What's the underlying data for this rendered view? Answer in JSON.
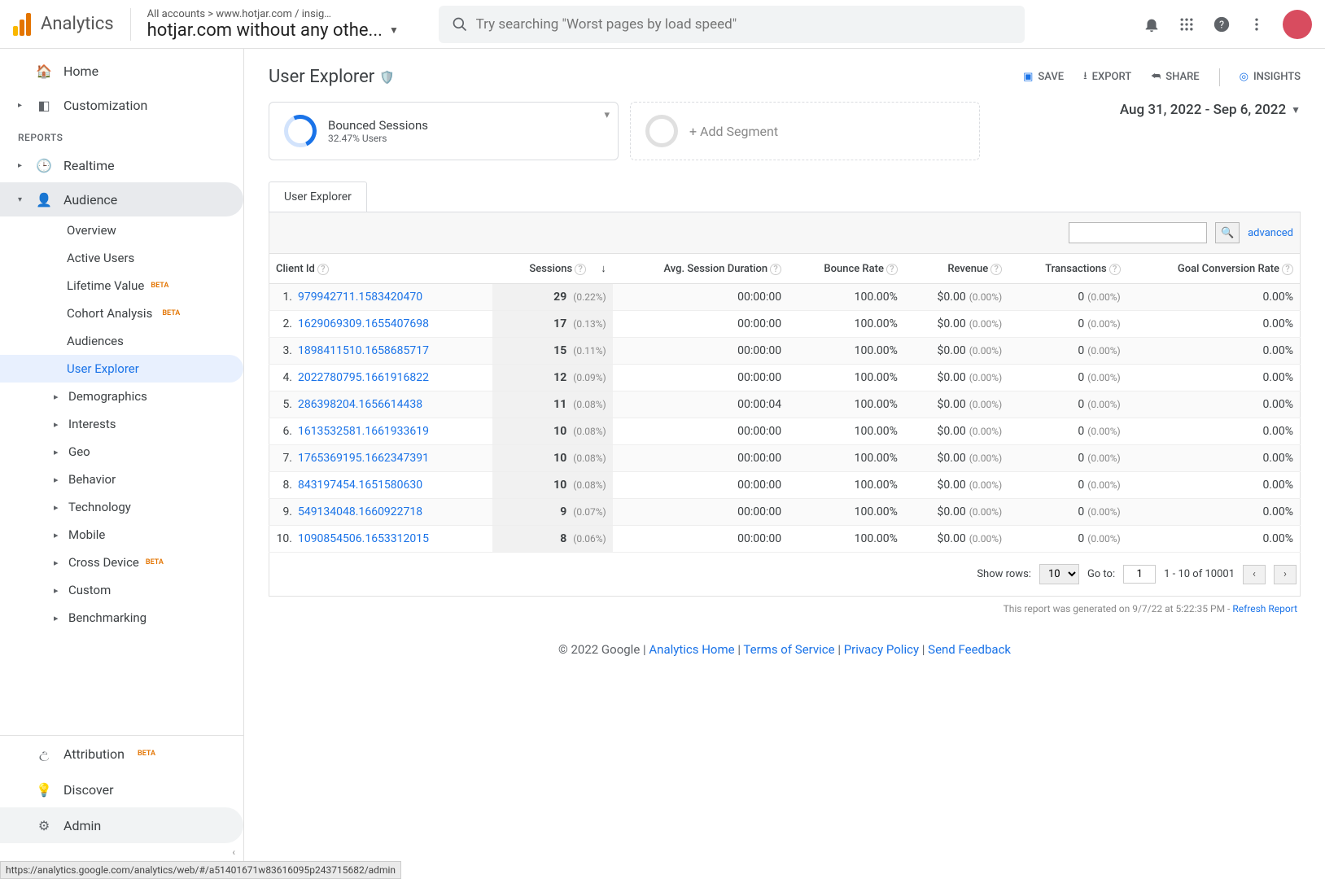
{
  "brand": "Analytics",
  "breadcrumb": "All accounts > www.hotjar.com / insig…",
  "property": "hotjar.com without any othe...",
  "search_placeholder": "Try searching \"Worst pages by load speed\"",
  "sidebar": {
    "home": "Home",
    "customization": "Customization",
    "reports_label": "REPORTS",
    "realtime": "Realtime",
    "audience": "Audience",
    "sub": {
      "overview": "Overview",
      "active_users": "Active Users",
      "lifetime_value": "Lifetime Value",
      "cohort": "Cohort Analysis",
      "audiences": "Audiences",
      "user_explorer": "User Explorer",
      "demographics": "Demographics",
      "interests": "Interests",
      "geo": "Geo",
      "behavior": "Behavior",
      "technology": "Technology",
      "mobile": "Mobile",
      "cross_device": "Cross Device",
      "custom": "Custom",
      "benchmarking": "Benchmarking"
    },
    "attribution": "Attribution",
    "discover": "Discover",
    "admin": "Admin",
    "beta": "BETA"
  },
  "page": {
    "title": "User Explorer",
    "save": "SAVE",
    "export": "EXPORT",
    "share": "SHARE",
    "insights": "INSIGHTS"
  },
  "segment": {
    "title": "Bounced Sessions",
    "subtitle": "32.47% Users",
    "add": "+ Add Segment"
  },
  "date_range": "Aug 31, 2022 - Sep 6, 2022",
  "tab": "User Explorer",
  "advanced": "advanced",
  "columns": {
    "client_id": "Client Id",
    "sessions": "Sessions",
    "avg_duration": "Avg. Session Duration",
    "bounce": "Bounce Rate",
    "revenue": "Revenue",
    "transactions": "Transactions",
    "goal_rate": "Goal Conversion Rate"
  },
  "rows": [
    {
      "n": "1.",
      "id": "979942711.1583420470",
      "s": "29",
      "sp": "(0.22%)",
      "d": "00:00:00",
      "b": "100.00%",
      "r": "$0.00",
      "rp": "(0.00%)",
      "t": "0",
      "tp": "(0.00%)",
      "g": "0.00%"
    },
    {
      "n": "2.",
      "id": "1629069309.1655407698",
      "s": "17",
      "sp": "(0.13%)",
      "d": "00:00:00",
      "b": "100.00%",
      "r": "$0.00",
      "rp": "(0.00%)",
      "t": "0",
      "tp": "(0.00%)",
      "g": "0.00%"
    },
    {
      "n": "3.",
      "id": "1898411510.1658685717",
      "s": "15",
      "sp": "(0.11%)",
      "d": "00:00:00",
      "b": "100.00%",
      "r": "$0.00",
      "rp": "(0.00%)",
      "t": "0",
      "tp": "(0.00%)",
      "g": "0.00%"
    },
    {
      "n": "4.",
      "id": "2022780795.1661916822",
      "s": "12",
      "sp": "(0.09%)",
      "d": "00:00:00",
      "b": "100.00%",
      "r": "$0.00",
      "rp": "(0.00%)",
      "t": "0",
      "tp": "(0.00%)",
      "g": "0.00%"
    },
    {
      "n": "5.",
      "id": "286398204.1656614438",
      "s": "11",
      "sp": "(0.08%)",
      "d": "00:00:04",
      "b": "100.00%",
      "r": "$0.00",
      "rp": "(0.00%)",
      "t": "0",
      "tp": "(0.00%)",
      "g": "0.00%"
    },
    {
      "n": "6.",
      "id": "1613532581.1661933619",
      "s": "10",
      "sp": "(0.08%)",
      "d": "00:00:00",
      "b": "100.00%",
      "r": "$0.00",
      "rp": "(0.00%)",
      "t": "0",
      "tp": "(0.00%)",
      "g": "0.00%"
    },
    {
      "n": "7.",
      "id": "1765369195.1662347391",
      "s": "10",
      "sp": "(0.08%)",
      "d": "00:00:00",
      "b": "100.00%",
      "r": "$0.00",
      "rp": "(0.00%)",
      "t": "0",
      "tp": "(0.00%)",
      "g": "0.00%"
    },
    {
      "n": "8.",
      "id": "843197454.1651580630",
      "s": "10",
      "sp": "(0.08%)",
      "d": "00:00:00",
      "b": "100.00%",
      "r": "$0.00",
      "rp": "(0.00%)",
      "t": "0",
      "tp": "(0.00%)",
      "g": "0.00%"
    },
    {
      "n": "9.",
      "id": "549134048.1660922718",
      "s": "9",
      "sp": "(0.07%)",
      "d": "00:00:00",
      "b": "100.00%",
      "r": "$0.00",
      "rp": "(0.00%)",
      "t": "0",
      "tp": "(0.00%)",
      "g": "0.00%"
    },
    {
      "n": "10.",
      "id": "1090854506.1653312015",
      "s": "8",
      "sp": "(0.06%)",
      "d": "00:00:00",
      "b": "100.00%",
      "r": "$0.00",
      "rp": "(0.00%)",
      "t": "0",
      "tp": "(0.00%)",
      "g": "0.00%"
    }
  ],
  "pager": {
    "show_rows": "Show rows:",
    "rows_value": "10",
    "goto": "Go to:",
    "goto_value": "1",
    "range": "1 - 10 of 10001"
  },
  "generated": "This report was generated on 9/7/22 at 5:22:35 PM - ",
  "refresh": "Refresh Report",
  "footer": {
    "copyright": "© 2022 Google",
    "home": "Analytics Home",
    "tos": "Terms of Service",
    "privacy": "Privacy Policy",
    "feedback": "Send Feedback"
  },
  "status_url": "https://analytics.google.com/analytics/web/#/a51401671w83616095p243715682/admin"
}
